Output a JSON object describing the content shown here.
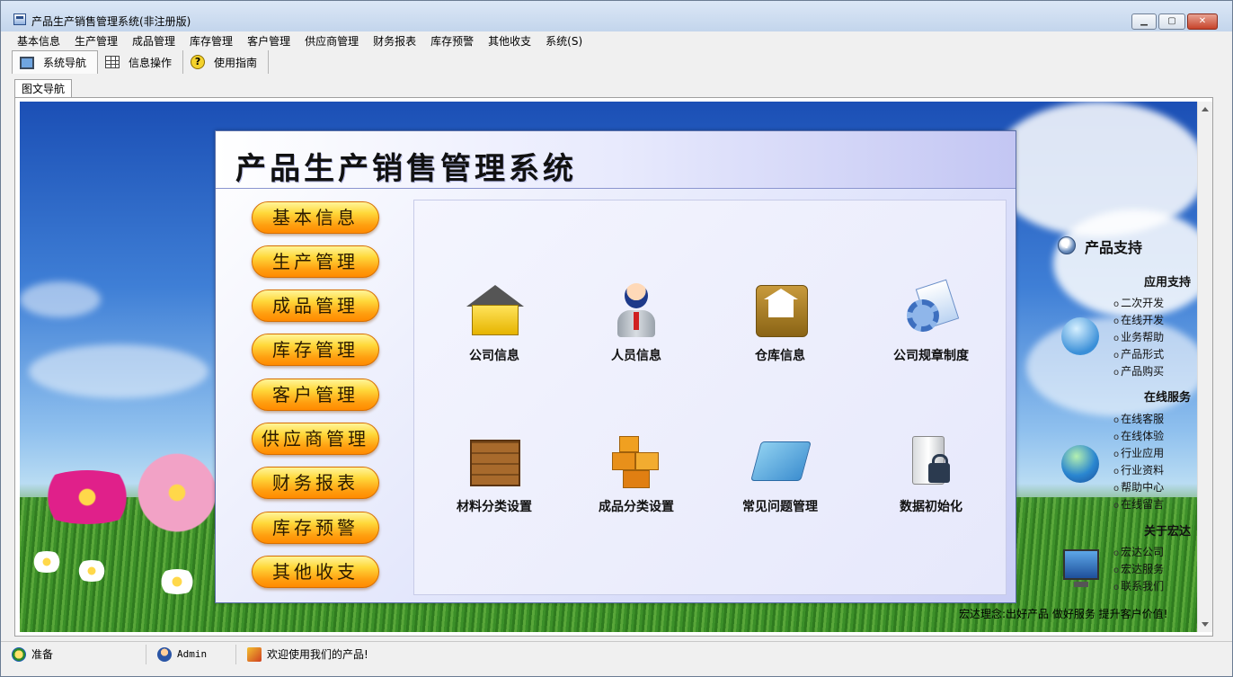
{
  "window": {
    "title": "产品生产销售管理系统(非注册版)"
  },
  "menu": {
    "items": [
      "基本信息",
      "生产管理",
      "成品管理",
      "库存管理",
      "客户管理",
      "供应商管理",
      "财务报表",
      "库存预警",
      "其他收支",
      "系统(S)"
    ]
  },
  "toolbar": {
    "nav_label": "系统导航",
    "info_label": "信息操作",
    "guide_label": "使用指南"
  },
  "doc_tab": {
    "label": "图文导航"
  },
  "panel": {
    "title": "产品生产销售管理系统",
    "nav_buttons": [
      "基本信息",
      "生产管理",
      "成品管理",
      "库存管理",
      "客户管理",
      "供应商管理",
      "财务报表",
      "库存预警",
      "其他收支"
    ],
    "tiles": [
      {
        "label": "公司信息",
        "icon": "house-icon"
      },
      {
        "label": "人员信息",
        "icon": "person-icon"
      },
      {
        "label": "仓库信息",
        "icon": "warehouse-icon"
      },
      {
        "label": "公司规章制度",
        "icon": "gear-document-icon"
      },
      {
        "label": "材料分类设置",
        "icon": "crate-icon"
      },
      {
        "label": "成品分类设置",
        "icon": "boxes-icon"
      },
      {
        "label": "常见问题管理",
        "icon": "folder-icon"
      },
      {
        "label": "数据初始化",
        "icon": "server-lock-icon"
      }
    ]
  },
  "support": {
    "title": "产品支持",
    "app_support": {
      "heading": "应用支持",
      "links": [
        "二次开发",
        "在线开发",
        "业务帮助",
        "产品形式",
        "产品购买"
      ]
    },
    "online_service": {
      "heading": "在线服务",
      "links": [
        "在线客服",
        "在线体验",
        "行业应用",
        "行业资料",
        "帮助中心",
        "在线留言"
      ]
    },
    "about": {
      "heading": "关于宏达",
      "links": [
        "宏达公司",
        "宏达服务",
        "联系我们"
      ]
    },
    "motto": "宏达理念:出好产品  做好服务  提升客户价值!"
  },
  "status": {
    "ready": "准备",
    "user": "Admin",
    "welcome": "欢迎使用我们的产品!"
  },
  "colors": {
    "nav_button_top": "#fff59a",
    "nav_button_bottom": "#ff8a00",
    "panel_accent": "#c9cdf5"
  }
}
